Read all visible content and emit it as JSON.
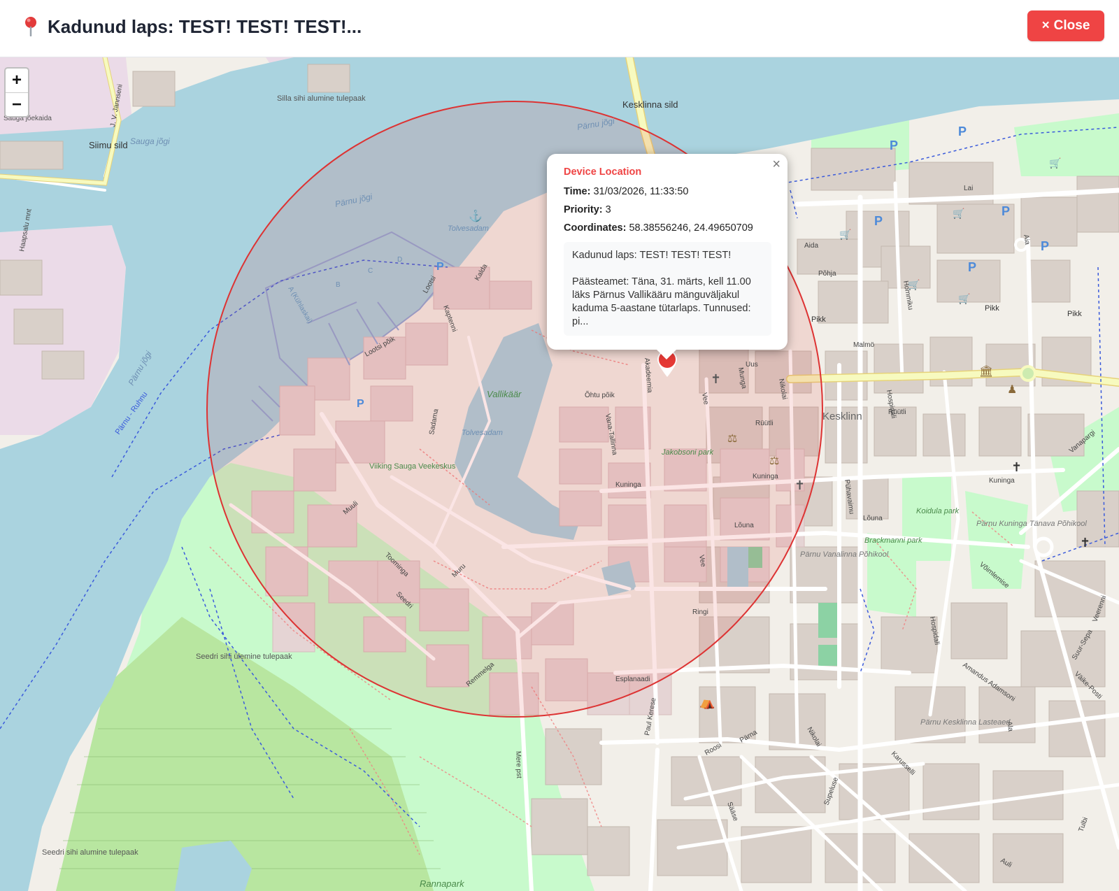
{
  "header": {
    "title": "Kadunud laps: TEST! TEST! TEST!...",
    "close_label": "Close",
    "close_icon": "×",
    "pin_icon": "pin-icon"
  },
  "zoom": {
    "in_label": "+",
    "out_label": "−"
  },
  "popup": {
    "heading": "Device Location",
    "close_glyph": "×",
    "time_label": "Time:",
    "time_value": "31/03/2026, 11:33:50",
    "priority_label": "Priority:",
    "priority_value": "3",
    "coords_label": "Coordinates:",
    "coords_value": "58.38556246, 24.49650709",
    "message_line1": "Kadunud laps: TEST! TEST! TEST!",
    "message_line2": "Päästeamet: Täna, 31. märts, kell 11.00 läks Pärnus Vallikääru mänguväljakul kaduma 5-aastane tütarlaps. Tunnused: pi..."
  },
  "map_labels": {
    "kesklinna_sild": "Kesklinna sild",
    "siimu_sild": "Siimu sild",
    "sauga_joekaida": "Sauga jõekaida",
    "sauga_jogi": "Sauga jõgi",
    "parnu_jogi": "Pärnu jõgi",
    "parnu_ruhnu": "Pärnu - Ruhnu",
    "silla_tulepaak": "Silla sihi alumine tulepaak",
    "seedri_ulemine": "Seedri sihi ülemine tulepaak",
    "seedri_alumine": "Seedri sihi alumine tulepaak",
    "tolvesadam": "Tolvesadam",
    "vallikaar": "Vallikäär",
    "kesklinn": "Kesklinn",
    "jakobsoni_park": "Jakobsoni park",
    "koidula_park": "Koidula park",
    "brackmanni_park": "Brackmanni park",
    "viiking": "Viiking Sauga Veekeskus",
    "vanalinna_pohikool": "Pärnu Vanalinna Põhikool",
    "kuninga_pohikool": "Pärnu Kuninga Tänava Põhikool",
    "kesklinna_lasteaed": "Pärnu Kesklinna Lasteaed",
    "rannapark": "Rannapark",
    "street_pikk": "Pikk",
    "street_kuninga": "Kuninga",
    "street_ruutli": "Rüütli",
    "street_uus": "Uus",
    "street_malmo": "Malmö",
    "street_ringi": "Ringi",
    "street_esplanaadi": "Esplanaadi",
    "street_louna": "Lõuna",
    "street_lai": "Lai",
    "street_pohja": "Põhja",
    "street_aida": "Aida",
    "street_vee": "Vee",
    "street_nikolai": "Nikolai",
    "street_ala": "Ala",
    "street_hospidali": "Hospidali",
    "street_akadeemia": "Akadeemia",
    "street_supeluse": "Supeluse",
    "street_karusselli": "Karusselli",
    "street_roosi": "Roosi",
    "street_parna": "Pärna",
    "street_saase": "Sääse",
    "street_mere": "Mere pst",
    "street_paul_kerese": "Paul Kerese",
    "street_jv_jannseni": "J. V. Jannseni",
    "street_haapsalu": "Haapsalu mnt",
    "street_ohtu": "Õhtu põik",
    "street_vana_tallinna": "Vana-Tallinna",
    "street_muru": "Muru",
    "street_sadama": "Sadama",
    "street_kalda": "Kalda",
    "street_laotsi": "Lootsi",
    "street_kaptein": "Kaptenni",
    "street_seedri": "Seedri",
    "street_toominga": "Toominga",
    "street_muuli": "Muuli",
    "street_remmelga": "Remmelga",
    "street_hommiku": "Hommiku",
    "street_munga": "Munga",
    "street_kuninga2": "Kuninga",
    "street_aia": "Aia",
    "street_puhavaimu": "Pühavaimu",
    "street_vanapargi": "Vanapargi",
    "street_veerenni": "Veerenni",
    "street_voimlemise": "Võimlemise",
    "street_amandus": "Amandus Adamsoni",
    "street_suur_sepa": "Suur-Sepa",
    "street_vaike_posti": "Väike-Posti",
    "street_tulbi": "Tulbi",
    "street_auli": "Auli",
    "street_a_kuhlaskai": "A (Kühlaskai)",
    "street_looru": "Lootsi põik",
    "pier_b": "B",
    "pier_c": "C",
    "pier_d": "D",
    "parking": "P"
  },
  "colors": {
    "accent_red": "#ef4444",
    "water": "#aad3df",
    "park": "#c8facc",
    "radius_circle": "#dd3333"
  }
}
